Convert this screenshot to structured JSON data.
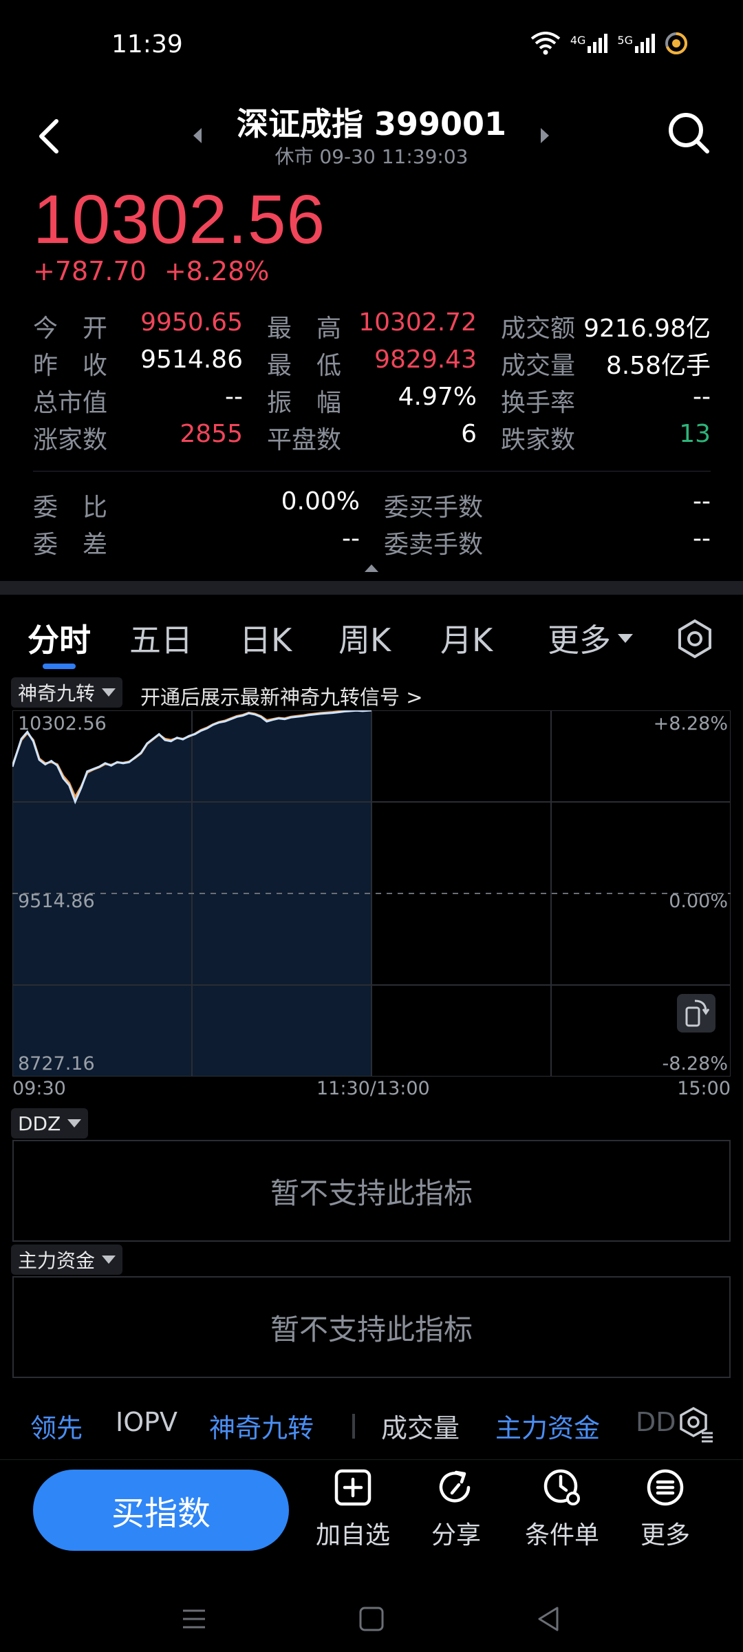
{
  "status_bar": {
    "time": "11:39",
    "network_1": "4G",
    "network_2": "5G"
  },
  "header": {
    "title": "深证成指 399001",
    "subtitle": "休市 09-30 11:39:03"
  },
  "quote": {
    "price": "10302.56",
    "change": "+787.70",
    "change_pct": "+8.28%"
  },
  "stats": {
    "open_label": "今　开",
    "open_value": "9950.65",
    "high_label": "最　高",
    "high_value": "10302.72",
    "turnover_label": "成交额",
    "turnover_value": "9216.98亿",
    "prev_close_label": "昨　收",
    "prev_close_value": "9514.86",
    "low_label": "最　低",
    "low_value": "9829.43",
    "volume_label": "成交量",
    "volume_value": "8.58亿手",
    "mktcap_label": "总市值",
    "mktcap_value": "--",
    "amplitude_label": "振　幅",
    "amplitude_value": "4.97%",
    "turnover_rate_label": "换手率",
    "turnover_rate_value": "--",
    "advancers_label": "涨家数",
    "advancers_value": "2855",
    "unchanged_label": "平盘数",
    "unchanged_value": "6",
    "decliners_label": "跌家数",
    "decliners_value": "13",
    "order_ratio_label": "委　比",
    "order_ratio_value": "0.00%",
    "bid_lots_label": "委买手数",
    "bid_lots_value": "--",
    "order_diff_label": "委　差",
    "order_diff_value": "--",
    "ask_lots_label": "委卖手数",
    "ask_lots_value": "--"
  },
  "tabs": [
    "分时",
    "五日",
    "日K",
    "周K",
    "月K",
    "更多"
  ],
  "active_tab": "分时",
  "indicator_chip": "神奇九转",
  "hint_text": "开通后展示最新神奇九转信号 >",
  "chart_data": {
    "type": "line",
    "title": "",
    "y_top_label": "10302.56",
    "y_mid_label": "9514.86",
    "y_bottom_label": "8727.16",
    "pct_top_label": "+8.28%",
    "pct_mid_label": "0.00%",
    "pct_bottom_label": "-8.28%",
    "x_labels": [
      "09:30",
      "11:30/13:00",
      "15:00"
    ],
    "ylim": [
      8727.16,
      10302.56
    ],
    "baseline": 9514.86,
    "total_minutes": 240,
    "x": [
      0,
      3,
      5,
      7,
      9,
      11,
      13,
      15,
      17,
      19,
      21,
      23,
      25,
      27,
      29,
      31,
      33,
      35,
      37,
      39,
      41,
      43,
      45,
      47,
      49,
      51,
      53,
      55,
      57,
      59,
      61,
      63,
      65,
      67,
      69,
      71,
      73,
      75,
      77,
      79,
      81,
      83,
      85,
      87,
      89,
      91,
      93,
      95,
      97,
      99,
      101,
      103,
      105,
      107,
      109,
      111,
      113,
      115,
      117,
      119,
      120
    ],
    "series": [
      {
        "name": "",
        "color": "#cfe4ff",
        "values": [
          10060,
          10180,
          10210,
          10170,
          10090,
          10070,
          10085,
          10065,
          10010,
          9980,
          9910,
          9970,
          10040,
          10050,
          10060,
          10075,
          10065,
          10080,
          10075,
          10080,
          10100,
          10120,
          10160,
          10180,
          10200,
          10175,
          10170,
          10185,
          10178,
          10192,
          10200,
          10215,
          10225,
          10240,
          10250,
          10255,
          10265,
          10275,
          10280,
          10290,
          10285,
          10275,
          10255,
          10262,
          10268,
          10265,
          10272,
          10275,
          10278,
          10282,
          10285,
          10288,
          10290,
          10292,
          10295,
          10298,
          10300,
          10302,
          10300,
          10302,
          10302.56
        ]
      },
      {
        "name": "",
        "color": "#f0a050",
        "values": [
          10065,
          10175,
          10205,
          10175,
          10095,
          10075,
          10080,
          10070,
          10020,
          9990,
          9930,
          9975,
          10035,
          10048,
          10058,
          10072,
          10068,
          10078,
          10077,
          10082,
          10098,
          10118,
          10158,
          10178,
          10198,
          10180,
          10175,
          10183,
          10180,
          10190,
          10202,
          10218,
          10228,
          10242,
          10252,
          10258,
          10268,
          10278,
          10283,
          10292,
          10288,
          10278,
          10260,
          10265,
          10270,
          10268,
          10275,
          10278,
          10281,
          10285,
          10288,
          10291,
          10293,
          10295,
          10298,
          10300,
          10302,
          10304,
          10303,
          10304,
          10304
        ]
      }
    ],
    "grid": true
  },
  "ddz_chip": "DDZ",
  "ddz_message": "暂不支持此指标",
  "main_fund_chip": "主力资金",
  "main_fund_message": "暂不支持此指标",
  "bottom_tabs": [
    "领先",
    "IOPV",
    "神奇九转",
    "成交量",
    "主力资金",
    "DD"
  ],
  "actions": {
    "buy": "买指数",
    "watchlist": "加自选",
    "share": "分享",
    "conditional_order": "条件单",
    "more": "更多"
  }
}
